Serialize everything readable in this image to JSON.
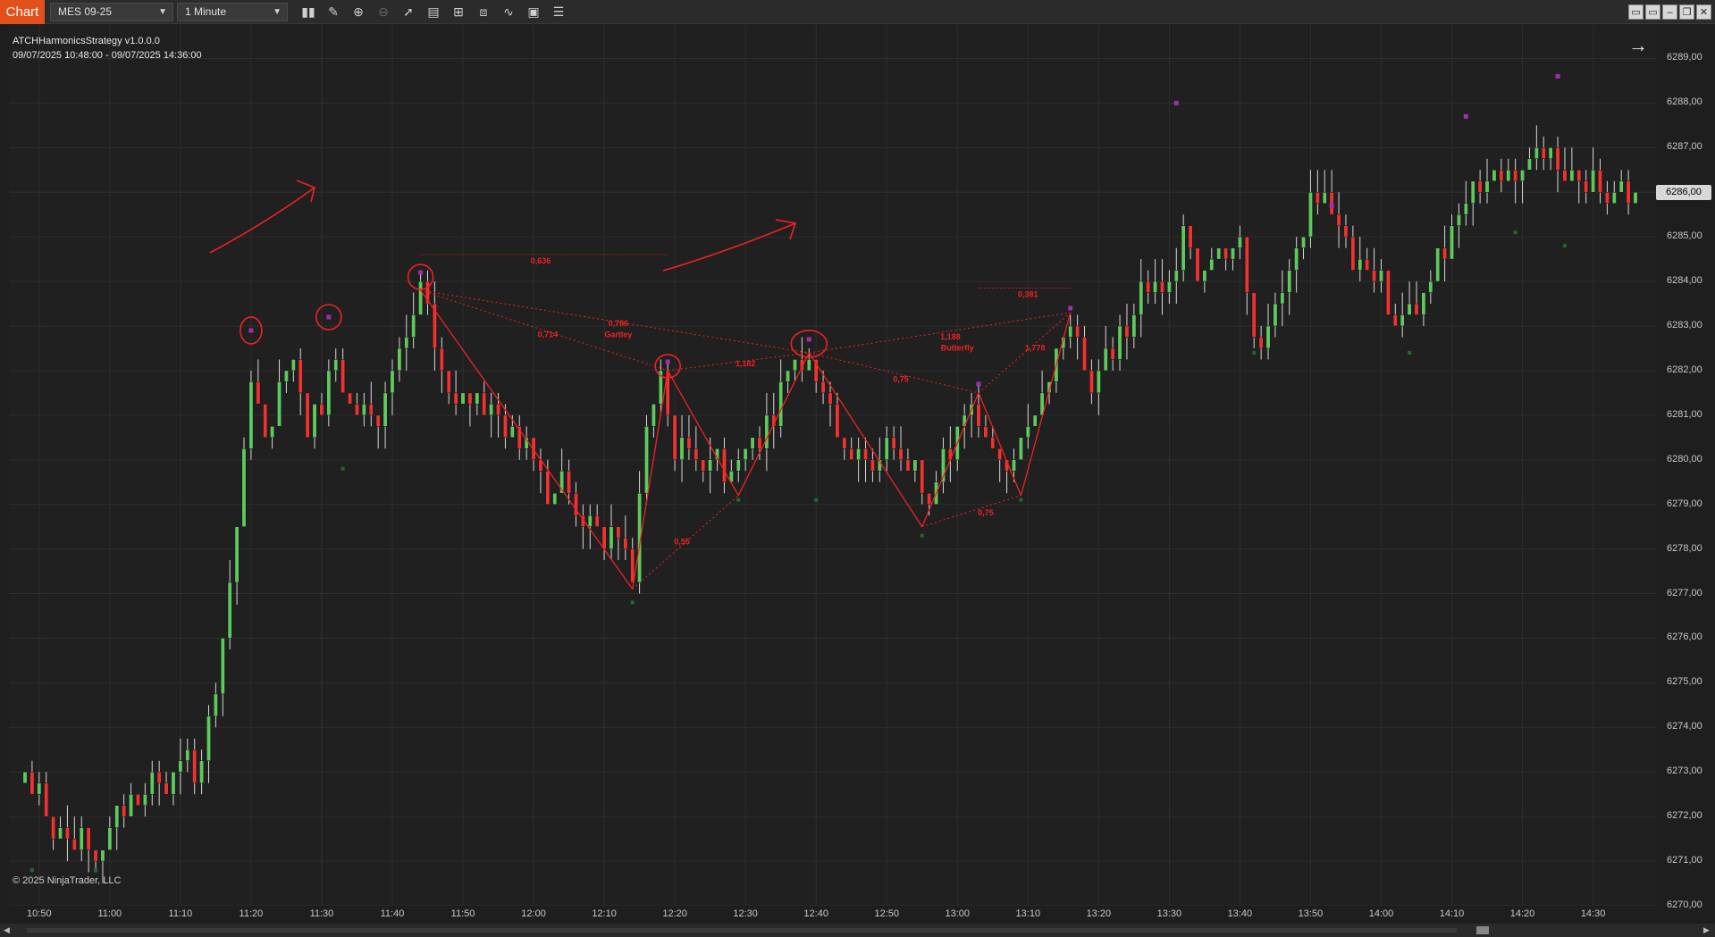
{
  "toolbar": {
    "chart_tab": "Chart",
    "instrument": "MES 09-25",
    "interval": "1 Minute",
    "tools": [
      {
        "name": "bars-type-icon",
        "glyph": "▮▮"
      },
      {
        "name": "drawing-tool-icon",
        "glyph": "✎"
      },
      {
        "name": "zoom-in-icon",
        "glyph": "⊕"
      },
      {
        "name": "zoom-out-icon",
        "glyph": "⊖"
      },
      {
        "name": "pointer-icon",
        "glyph": "➚"
      },
      {
        "name": "data-box-icon",
        "glyph": "▤"
      },
      {
        "name": "chart-trader-icon",
        "glyph": "⊞"
      },
      {
        "name": "strategies-icon",
        "glyph": "⧈"
      },
      {
        "name": "indicators-icon",
        "glyph": "∿"
      },
      {
        "name": "templates-icon",
        "glyph": "▣"
      },
      {
        "name": "properties-icon",
        "glyph": "☰"
      }
    ]
  },
  "strategy": {
    "name": "ATCHHarmonicsStrategy  v1.0.0.0",
    "range": "09/07/2025 10:48:00 - 09/07/2025 14:36:00"
  },
  "copyright": "© 2025 NinjaTrader, LLC",
  "current_price": "6286,00",
  "colors": {
    "up": "#5ec95e",
    "down": "#ee3333",
    "wick": "#d8d8d8",
    "pattern": "#ee2222",
    "pivot": "#9b2fae",
    "background": "#202020"
  },
  "patterns": [
    {
      "name": "Gartley",
      "ratios": [
        "0,636",
        "0,714",
        "0,786",
        "1,182",
        "0,55"
      ]
    },
    {
      "name": "Butterfly",
      "ratios": [
        "0,381",
        "1,188",
        "0,75",
        "1,778",
        "0,75"
      ]
    }
  ],
  "chart_data": {
    "type": "candlestick",
    "ylim": [
      6270,
      6289.75
    ],
    "y_ticks": [
      "6289,00",
      "6288,00",
      "6287,00",
      "6286,00",
      "6285,00",
      "6284,00",
      "6283,00",
      "6282,00",
      "6281,00",
      "6280,00",
      "6279,00",
      "6278,00",
      "6277,00",
      "6276,00",
      "6275,00",
      "6274,00",
      "6273,00",
      "6272,00",
      "6271,00",
      "6270,00"
    ],
    "x_ticks": [
      "10:50",
      "11:00",
      "11:10",
      "11:20",
      "11:30",
      "11:40",
      "11:50",
      "12:00",
      "12:10",
      "12:20",
      "12:30",
      "12:40",
      "12:50",
      "13:00",
      "13:10",
      "13:20",
      "13:30",
      "13:40",
      "13:50",
      "14:00",
      "14:10",
      "14:20",
      "14:30"
    ],
    "time_start": "10:48",
    "time_end": "14:36",
    "path_points": [
      [
        "10:48",
        6272.8
      ],
      [
        "10:52",
        6271.6
      ],
      [
        "10:56",
        6271.8
      ],
      [
        "10:58",
        6271.1
      ],
      [
        "11:00",
        6271.8
      ],
      [
        "11:04",
        6272.6
      ],
      [
        "11:10",
        6272.9
      ],
      [
        "11:12",
        6273.0
      ],
      [
        "11:14",
        6274.0
      ],
      [
        "11:16",
        6276.0
      ],
      [
        "11:18",
        6278.5
      ],
      [
        "11:19",
        6280.0
      ],
      [
        "11:20",
        6282.0
      ],
      [
        "11:22",
        6280.4
      ],
      [
        "11:24",
        6281.5
      ],
      [
        "11:26",
        6282.3
      ],
      [
        "11:28",
        6280.8
      ],
      [
        "11:30",
        6281.5
      ],
      [
        "11:32",
        6282.2
      ],
      [
        "11:34",
        6281.0
      ],
      [
        "11:36",
        6281.2
      ],
      [
        "11:38",
        6280.9
      ],
      [
        "11:40",
        6281.8
      ],
      [
        "11:42",
        6282.6
      ],
      [
        "11:44",
        6283.8
      ],
      [
        "11:46",
        6282.6
      ],
      [
        "11:48",
        6281.3
      ],
      [
        "11:52",
        6281.5
      ],
      [
        "11:56",
        6280.6
      ],
      [
        "12:00",
        6280.4
      ],
      [
        "12:02",
        6279.2
      ],
      [
        "12:04",
        6279.6
      ],
      [
        "12:06",
        6278.8
      ],
      [
        "12:10",
        6278.1
      ],
      [
        "12:12",
        6278.6
      ],
      [
        "12:14",
        6277.3
      ],
      [
        "12:16",
        6280.8
      ],
      [
        "12:18",
        6281.8
      ],
      [
        "12:20",
        6280.2
      ],
      [
        "12:22",
        6280.4
      ],
      [
        "12:26",
        6280.0
      ],
      [
        "12:28",
        6279.6
      ],
      [
        "12:30",
        6280.4
      ],
      [
        "12:34",
        6281.2
      ],
      [
        "12:36",
        6281.8
      ],
      [
        "12:38",
        6282.4
      ],
      [
        "12:40",
        6282.0
      ],
      [
        "12:42",
        6281.3
      ],
      [
        "12:44",
        6280.4
      ],
      [
        "12:48",
        6280.0
      ],
      [
        "12:50",
        6280.4
      ],
      [
        "12:54",
        6279.8
      ],
      [
        "12:56",
        6279.2
      ],
      [
        "12:58",
        6280.0
      ],
      [
        "13:00",
        6280.4
      ],
      [
        "13:02",
        6281.2
      ],
      [
        "13:04",
        6280.6
      ],
      [
        "13:06",
        6280.2
      ],
      [
        "13:08",
        6279.8
      ],
      [
        "13:10",
        6280.8
      ],
      [
        "13:12",
        6281.6
      ],
      [
        "13:14",
        6282.4
      ],
      [
        "13:16",
        6283.0
      ],
      [
        "13:18",
        6281.8
      ],
      [
        "13:20",
        6281.8
      ],
      [
        "13:22",
        6282.4
      ],
      [
        "13:24",
        6283.2
      ],
      [
        "13:26",
        6283.8
      ],
      [
        "13:28",
        6284.0
      ],
      [
        "13:30",
        6283.5
      ],
      [
        "13:32",
        6285.4
      ],
      [
        "13:34",
        6284.2
      ],
      [
        "13:36",
        6284.6
      ],
      [
        "13:38",
        6284.8
      ],
      [
        "13:40",
        6284.6
      ],
      [
        "13:42",
        6282.8
      ],
      [
        "13:44",
        6283.2
      ],
      [
        "13:46",
        6283.6
      ],
      [
        "13:48",
        6284.6
      ],
      [
        "13:50",
        6285.8
      ],
      [
        "13:52",
        6286.0
      ],
      [
        "13:54",
        6285.4
      ],
      [
        "13:56",
        6284.6
      ],
      [
        "13:58",
        6284.8
      ],
      [
        "14:00",
        6283.9
      ],
      [
        "14:02",
        6283.2
      ],
      [
        "14:04",
        6283.4
      ],
      [
        "14:06",
        6283.6
      ],
      [
        "14:08",
        6284.6
      ],
      [
        "14:10",
        6285.0
      ],
      [
        "14:12",
        6285.6
      ],
      [
        "14:14",
        6286.2
      ],
      [
        "14:16",
        6286.6
      ],
      [
        "14:18",
        6286.0
      ],
      [
        "14:20",
        6286.3
      ],
      [
        "14:22",
        6286.8
      ],
      [
        "14:24",
        6287.0
      ],
      [
        "14:26",
        6286.0
      ],
      [
        "14:28",
        6286.5
      ],
      [
        "14:30",
        6286.3
      ],
      [
        "14:32",
        6285.8
      ],
      [
        "14:34",
        6286.0
      ],
      [
        "14:36",
        6286.0
      ]
    ],
    "gartley_lines": [
      [
        "11:44",
        6283.8
      ],
      [
        "12:14",
        6277.1
      ],
      [
        "12:19",
        6282.0
      ],
      [
        "12:29",
        6279.2
      ],
      [
        "12:39",
        6282.4
      ]
    ],
    "butterfly_lines": [
      [
        "12:39",
        6282.4
      ],
      [
        "12:55",
        6278.5
      ],
      [
        "13:03",
        6281.5
      ],
      [
        "13:09",
        6279.2
      ],
      [
        "13:16",
        6283.3
      ]
    ],
    "pivot_highs": [
      [
        "11:20",
        6282.9
      ],
      [
        "11:31",
        6283.2
      ],
      [
        "11:44",
        6284.2
      ],
      [
        "12:19",
        6282.2
      ],
      [
        "12:39",
        6282.7
      ],
      [
        "13:03",
        6281.7
      ],
      [
        "13:16",
        6283.4
      ],
      [
        "13:31",
        6288.0
      ],
      [
        "13:53",
        6285.7
      ],
      [
        "14:12",
        6287.7
      ],
      [
        "14:25",
        6288.6
      ]
    ],
    "pivot_lows": [
      [
        "10:49",
        6270.8
      ],
      [
        "10:58",
        6270.8
      ],
      [
        "11:33",
        6279.8
      ],
      [
        "12:14",
        6276.8
      ],
      [
        "12:29",
        6279.1
      ],
      [
        "12:40",
        6279.1
      ],
      [
        "12:55",
        6278.3
      ],
      [
        "13:09",
        6279.1
      ],
      [
        "13:42",
        6282.4
      ],
      [
        "14:04",
        6282.4
      ],
      [
        "14:19",
        6285.1
      ],
      [
        "14:26",
        6284.8
      ]
    ]
  }
}
